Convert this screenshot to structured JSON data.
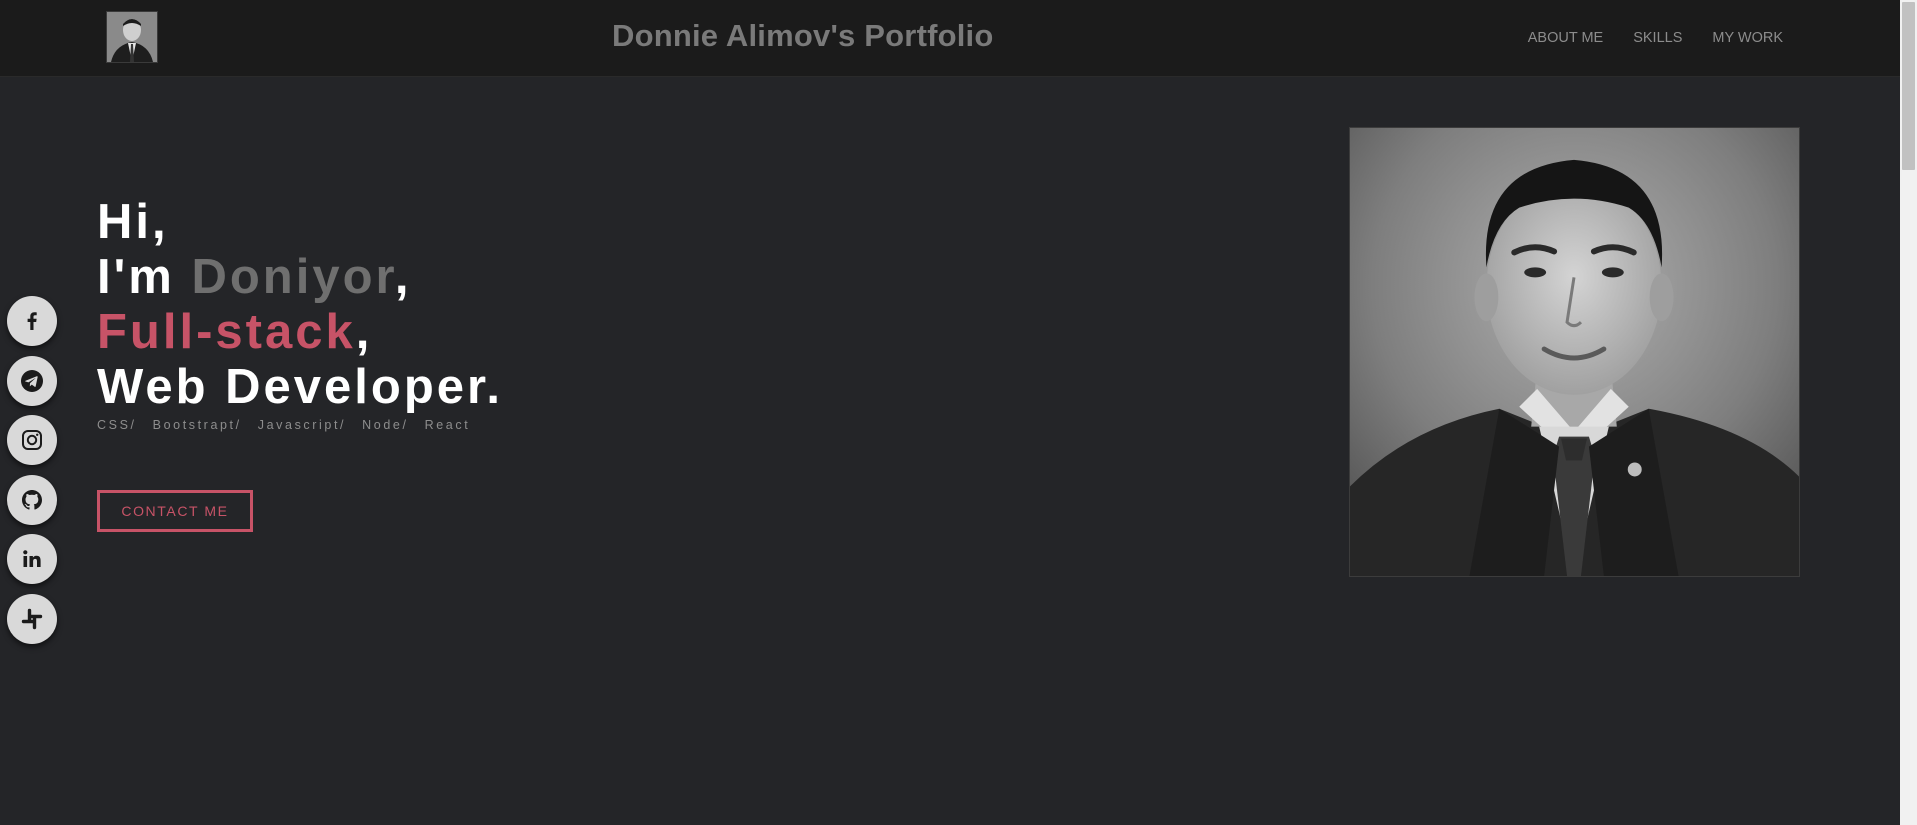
{
  "header": {
    "title": "Donnie Alimov's Portfolio",
    "nav": [
      {
        "label": "ABOUT ME"
      },
      {
        "label": "SKILLS"
      },
      {
        "label": "MY WORK"
      }
    ]
  },
  "social": [
    {
      "icon": "facebook-icon"
    },
    {
      "icon": "telegram-icon"
    },
    {
      "icon": "instagram-icon"
    },
    {
      "icon": "github-icon"
    },
    {
      "icon": "linkedin-icon"
    },
    {
      "icon": "slack-icon"
    }
  ],
  "hero": {
    "greeting": "Hi,",
    "im_prefix": "I'm ",
    "name": "Doniyor",
    "comma": ",",
    "role_accent": "Full-stack",
    "role_comma": ",",
    "role_rest": "Web Developer.",
    "tech": "CSS/ Bootstrapt/ Javascript/ Node/ React",
    "cta": "CONTACT ME"
  },
  "colors": {
    "background": "#242528",
    "navbar": "#1b1b1b",
    "accent": "#c75367",
    "name": "#6f6f6f"
  }
}
